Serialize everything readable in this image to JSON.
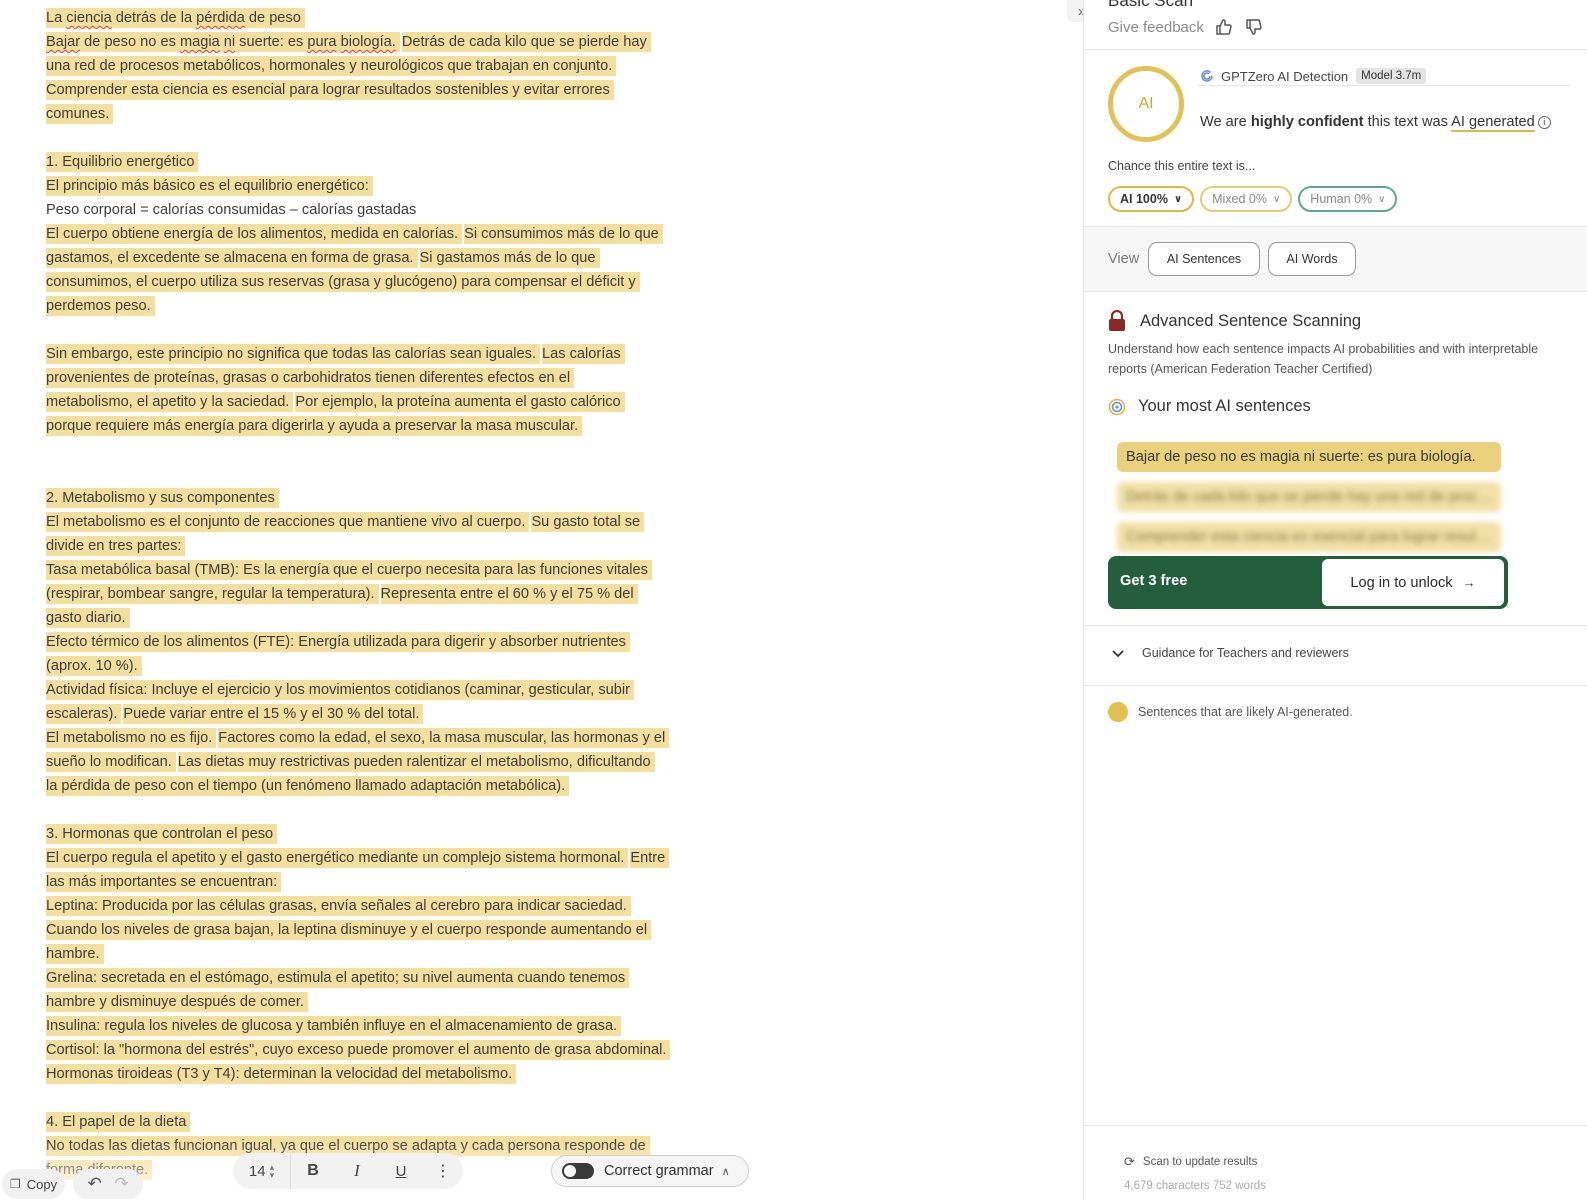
{
  "document": {
    "lines": [
      [
        {
          "t": "La ciencia detrás de la pérdida de peso",
          "hl": true
        }
      ],
      [
        {
          "t": "Bajar de peso no es magia ni suerte: es pura biología.",
          "hl": true
        },
        {
          "t": "Detrás de cada kilo que se pierde hay",
          "hl": true
        }
      ],
      [
        {
          "t": "una red de procesos metabólicos, hormonales y neurológicos que trabajan en conjunto.",
          "hl": true
        }
      ],
      [
        {
          "t": "Comprender esta ciencia es esencial para lograr resultados sostenibles y evitar errores",
          "hl": true
        }
      ],
      [
        {
          "t": "comunes.",
          "hl": true
        }
      ],
      [],
      [
        {
          "t": "1. Equilibrio energético",
          "hl": true
        }
      ],
      [
        {
          "t": "El principio más básico es el equilibrio energético:",
          "hl": true
        }
      ],
      [
        {
          "t": "Peso corporal = calorías consumidas – calorías gastadas",
          "hl": false
        }
      ],
      [
        {
          "t": "El cuerpo obtiene energía de los alimentos, medida en calorías.",
          "hl": true
        },
        {
          "t": "Si consumimos más de lo que",
          "hl": true
        }
      ],
      [
        {
          "t": "gastamos, el excedente se almacena en forma de grasa.",
          "hl": true
        },
        {
          "t": "Si gastamos más de lo que",
          "hl": true
        }
      ],
      [
        {
          "t": "consumimos, el cuerpo utiliza sus reservas (grasa y glucógeno) para compensar el déficit y",
          "hl": true
        }
      ],
      [
        {
          "t": "perdemos peso.",
          "hl": true
        }
      ],
      [],
      [
        {
          "t": "Sin embargo, este principio no significa que todas las calorías sean iguales.",
          "hl": true
        },
        {
          "t": "Las calorías",
          "hl": true
        }
      ],
      [
        {
          "t": "provenientes de proteínas, grasas o carbohidratos tienen diferentes efectos en el",
          "hl": true
        }
      ],
      [
        {
          "t": "metabolismo, el apetito y la saciedad.",
          "hl": true
        },
        {
          "t": "Por ejemplo, la proteína aumenta el gasto calórico",
          "hl": true
        }
      ],
      [
        {
          "t": "porque requiere más energía para digerirla y ayuda a preservar la masa muscular.",
          "hl": true
        }
      ],
      [],
      [],
      [
        {
          "t": "2. Metabolismo y sus componentes",
          "hl": true
        }
      ],
      [
        {
          "t": "El metabolismo es el conjunto de reacciones que mantiene vivo al cuerpo.",
          "hl": true
        },
        {
          "t": "Su gasto total se",
          "hl": true
        }
      ],
      [
        {
          "t": "divide en tres partes:",
          "hl": true
        }
      ],
      [
        {
          "t": "Tasa metabólica basal (TMB): Es la energía que el cuerpo necesita para las funciones vitales",
          "hl": true
        }
      ],
      [
        {
          "t": "(respirar, bombear sangre, regular la temperatura).",
          "hl": true
        },
        {
          "t": "Representa entre el 60 % y el 75 % del",
          "hl": true
        }
      ],
      [
        {
          "t": "gasto diario.",
          "hl": true
        }
      ],
      [
        {
          "t": "Efecto térmico de los alimentos (FTE): Energía utilizada para digerir y absorber nutrientes",
          "hl": true
        }
      ],
      [
        {
          "t": "(aprox. 10 %).",
          "hl": true
        }
      ],
      [
        {
          "t": "Actividad física: Incluye el ejercicio y los movimientos cotidianos (caminar, gesticular, subir",
          "hl": true
        }
      ],
      [
        {
          "t": "escaleras).",
          "hl": true
        },
        {
          "t": "Puede variar entre el 15 % y el 30 % del total.",
          "hl": true
        }
      ],
      [
        {
          "t": "El metabolismo no es fijo.",
          "hl": true
        },
        {
          "t": "Factores como la edad, el sexo, la masa muscular, las hormonas y el",
          "hl": true
        }
      ],
      [
        {
          "t": "sueño lo modifican.",
          "hl": true
        },
        {
          "t": "Las dietas muy restrictivas pueden ralentizar el metabolismo, dificultando",
          "hl": true
        }
      ],
      [
        {
          "t": "la pérdida de peso con el tiempo (un fenómeno llamado adaptación metabólica).",
          "hl": true
        }
      ],
      [],
      [
        {
          "t": "3. Hormonas que controlan el peso",
          "hl": true
        }
      ],
      [
        {
          "t": "El cuerpo regula el apetito y el gasto energético mediante un complejo sistema hormonal.",
          "hl": true
        },
        {
          "t": "Entre",
          "hl": true
        }
      ],
      [
        {
          "t": "las más importantes se encuentran:",
          "hl": true
        }
      ],
      [
        {
          "t": "Leptina: Producida por las células grasas, envía señales al cerebro para indicar saciedad.",
          "hl": true
        }
      ],
      [
        {
          "t": "Cuando los niveles de grasa bajan, la leptina disminuye y el cuerpo responde aumentando el",
          "hl": true
        }
      ],
      [
        {
          "t": "hambre.",
          "hl": true
        }
      ],
      [
        {
          "t": "Grelina: secretada en el estómago, estimula el apetito; su nivel aumenta cuando tenemos",
          "hl": true
        }
      ],
      [
        {
          "t": "hambre y disminuye después de comer.",
          "hl": true
        }
      ],
      [
        {
          "t": "Insulina: regula los niveles de glucosa y también influye en el almacenamiento de grasa.",
          "hl": true
        }
      ],
      [
        {
          "t": "Cortisol: la \"hormona del estrés\", cuyo exceso puede promover el aumento de grasa abdominal.",
          "hl": true
        }
      ],
      [
        {
          "t": "Hormonas tiroideas (T3 y T4): determinan la velocidad del metabolismo.",
          "hl": true
        }
      ],
      [],
      [
        {
          "t": "4. El papel de la dieta",
          "hl": true
        }
      ],
      [
        {
          "t": "No todas las dietas funcionan igual, ya que el cuerpo se adapta y cada persona responde de",
          "hl": true
        }
      ],
      [
        {
          "t": "forma diferente.",
          "hl": true
        }
      ]
    ]
  },
  "toolbar": {
    "copy_label": "Copy",
    "font_size": "14",
    "bold": "B",
    "italic": "I",
    "underline": "U",
    "grammar_label": "Correct grammar"
  },
  "panel": {
    "scan_title": "Basic Scan",
    "feedback_label": "Give feedback",
    "ring_label": "AI",
    "detector_name": "GPTZero AI Detection",
    "model_badge": "Model 3.7m",
    "confidence_prefix": "We are",
    "confidence_strong": "highly confident",
    "confidence_mid": "this text was",
    "confidence_result": "AI generated",
    "chance_label": "Chance this entire text is...",
    "pills": {
      "ai": "AI 100%",
      "mixed": "Mixed 0%",
      "human": "Human 0%"
    },
    "view_label": "View",
    "view_sentences": "AI Sentences",
    "view_words": "AI Words",
    "advanced_title": "Advanced Sentence Scanning",
    "advanced_desc": "Understand how each sentence impacts AI probabilities and with interpretable reports (American Federation Teacher Certified)",
    "most_title": "Your most AI sentences",
    "sentences": [
      "Bajar de peso no es magia ni suerte: es pura biología.",
      "Detrás de cada kilo que se pierde hay una red de procesos",
      "Comprender esta ciencia es esencial para lograr resultados"
    ],
    "cta_get": "Get 3 free",
    "cta_login": "Log in to unlock",
    "guidance_label": "Guidance for Teachers and reviewers",
    "legend_label": "Sentences that are likely AI-generated.",
    "rescan_label": "Scan to update results",
    "counts_label": "4,679 characters 752 words"
  },
  "colors": {
    "highlight": "#f5df9e",
    "ai_ring": "#dfc35a",
    "cta_green": "#245e3d",
    "human_green": "#5fa98a"
  }
}
